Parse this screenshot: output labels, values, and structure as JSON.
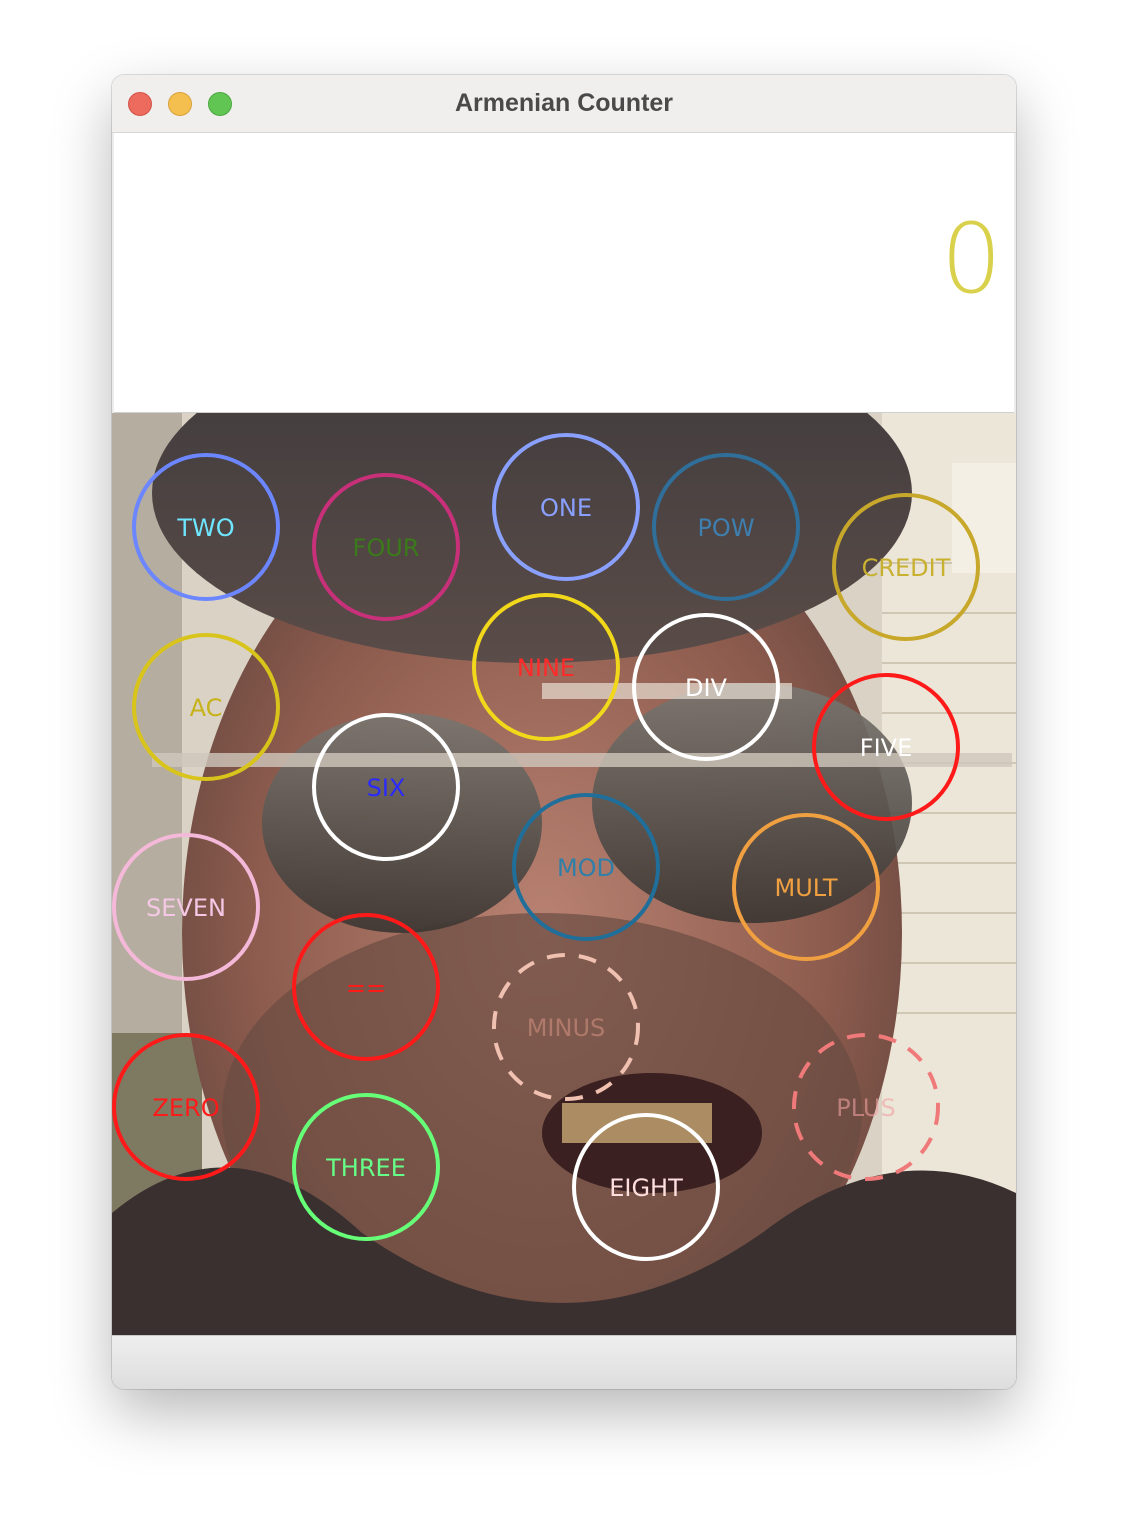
{
  "window": {
    "title": "Armenian Counter"
  },
  "display": {
    "value": "0",
    "color": "#d9d14c"
  },
  "buttons": [
    {
      "id": "two",
      "label": "TWO",
      "color": "#6c86ff",
      "text_color": "#6ee6ff",
      "dash": false
    },
    {
      "id": "four",
      "label": "FOUR",
      "color": "#c8307a",
      "text_color": "#3a7a1a",
      "dash": false
    },
    {
      "id": "one",
      "label": "ONE",
      "color": "#8aa0ff",
      "text_color": "#8aa0ff",
      "dash": false
    },
    {
      "id": "pow",
      "label": "POW",
      "color": "#2f6f9a",
      "text_color": "#3e7fb0",
      "dash": false
    },
    {
      "id": "credit",
      "label": "CREDIT",
      "color": "#c8a82a",
      "text_color": "#c8b030",
      "dash": false
    },
    {
      "id": "nine",
      "label": "NINE",
      "color": "#f2d81a",
      "text_color": "#ff2a2a",
      "dash": false
    },
    {
      "id": "div",
      "label": "DIV",
      "color": "#ffffff",
      "text_color": "#ffffff",
      "dash": false
    },
    {
      "id": "ac",
      "label": "AC",
      "color": "#d8c41a",
      "text_color": "#c8b21a",
      "dash": false
    },
    {
      "id": "five",
      "label": "FIVE",
      "color": "#ff1a1a",
      "text_color": "#ffffff",
      "dash": false
    },
    {
      "id": "six",
      "label": "SIX",
      "color": "#ffffff",
      "text_color": "#2a2aff",
      "dash": false
    },
    {
      "id": "mod",
      "label": "MOD",
      "color": "#1f6f9a",
      "text_color": "#2f7fa8",
      "dash": false
    },
    {
      "id": "mult",
      "label": "MULT",
      "color": "#f0a040",
      "text_color": "#f0a040",
      "dash": false
    },
    {
      "id": "seven",
      "label": "SEVEN",
      "color": "#f4b8d8",
      "text_color": "#f4c8e4",
      "dash": false
    },
    {
      "id": "equals",
      "label": "==",
      "color": "#ff1a1a",
      "text_color": "#ff1a1a",
      "dash": false
    },
    {
      "id": "minus",
      "label": "MINUS",
      "color": "#f0c0b0",
      "text_color": "#d09080",
      "dash": true
    },
    {
      "id": "zero",
      "label": "ZERO",
      "color": "#ff1a1a",
      "text_color": "#ff1a1a",
      "dash": false
    },
    {
      "id": "plus",
      "label": "PLUS",
      "color": "#f07a7a",
      "text_color": "#f0a0a0",
      "dash": true
    },
    {
      "id": "three",
      "label": "THREE",
      "color": "#66ff77",
      "text_color": "#66ff88",
      "dash": false
    },
    {
      "id": "eight",
      "label": "EIGHT",
      "color": "#ffffff",
      "text_color": "#ffdede",
      "dash": false
    }
  ]
}
